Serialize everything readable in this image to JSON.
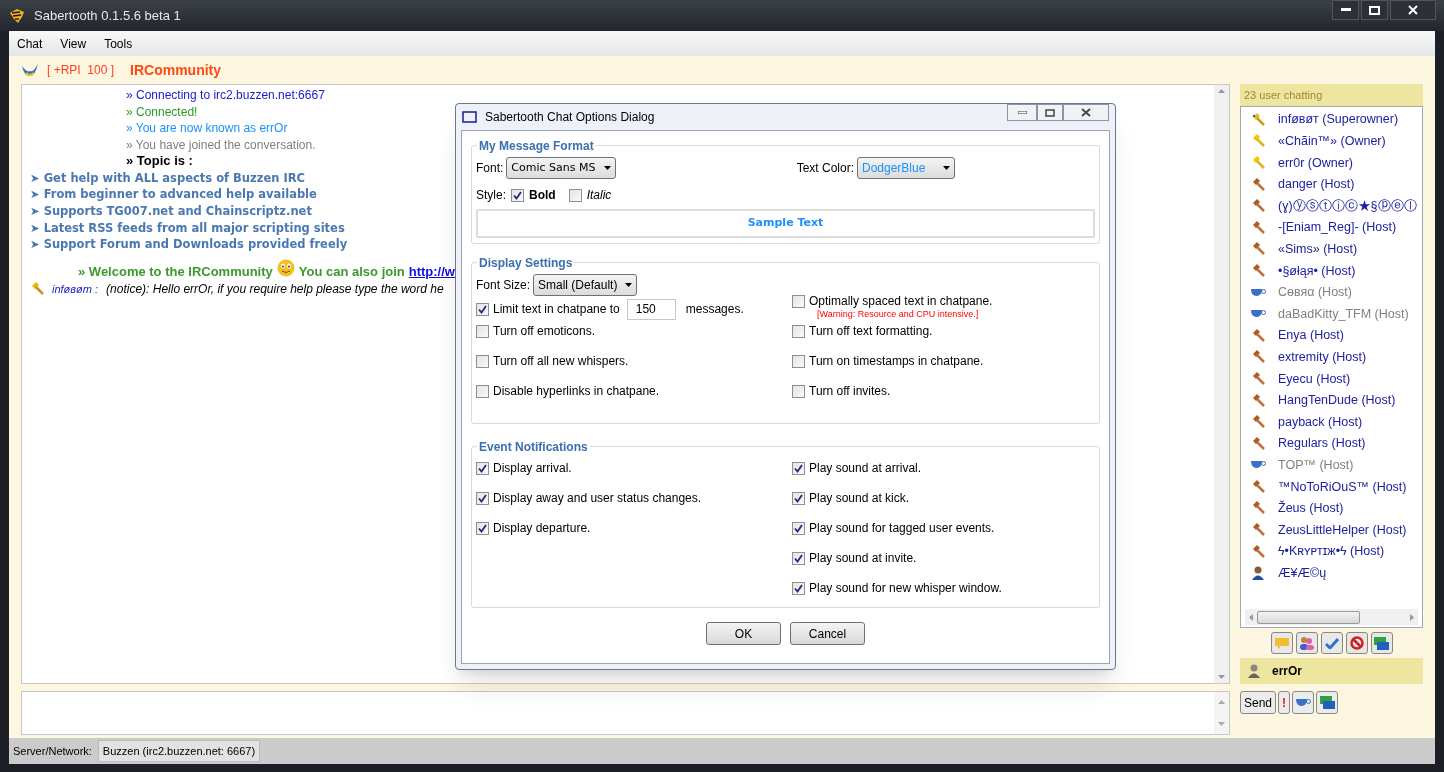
{
  "window": {
    "title": "Sabertooth 0.1.5.6 beta 1"
  },
  "menu": [
    "Chat",
    "View",
    "Tools"
  ],
  "header": {
    "rpi": "[ +RPI  100 ]",
    "room": "IRCommunity"
  },
  "chat": {
    "lines": [
      {
        "kind": "status",
        "color": "#1a1ad0",
        "text": "» Connecting to irc2.buzzen.net:6667"
      },
      {
        "kind": "status",
        "color": "#2a9a2a",
        "text": "» Connected!"
      },
      {
        "kind": "status",
        "color": "#1e90ff",
        "text": "» You are now known as errOr"
      },
      {
        "kind": "status",
        "color": "#808080",
        "text": "» You have joined the conversation."
      },
      {
        "kind": "topic_head",
        "color": "#000000",
        "text": "» Topic is :"
      },
      {
        "kind": "topic",
        "color": "#4a78b0",
        "text": "➤ Get help with ALL aspects of Buzzen IRC"
      },
      {
        "kind": "topic",
        "color": "#4a78b0",
        "text": "➤ From beginner to advanced help available"
      },
      {
        "kind": "topic",
        "color": "#4a78b0",
        "text": "➤ Supports TG007.net and Chainscriptz.net"
      },
      {
        "kind": "topic",
        "color": "#4a78b0",
        "text": "➤ Latest RSS feeds from all major scripting sites"
      },
      {
        "kind": "topic",
        "color": "#4a78b0",
        "text": "➤ Support Forum and Downloads provided freely"
      },
      {
        "kind": "welcome",
        "color": "#3a9a2a",
        "text": "» Welcome to the IRCommunity",
        "text2": "You can also join",
        "link": "http://w"
      },
      {
        "kind": "notice",
        "color": "#2020c0",
        "nick": "inføвøт :",
        "text": "(notice): Hello errOr, if you require help please type the word he"
      }
    ]
  },
  "user_panel": {
    "count": "23 user chatting",
    "users": [
      {
        "kind": "superowner",
        "name": "inføвøт (Superowner)"
      },
      {
        "kind": "owner",
        "name": "«Chãin™» (Owner)"
      },
      {
        "kind": "owner",
        "name": "err0r (Owner)"
      },
      {
        "kind": "host",
        "name": "danger (Host)"
      },
      {
        "kind": "host",
        "name": "(ɣ)ⓨⓢⓣⓘⓒ★§ⓟⓔⓛ"
      },
      {
        "kind": "host",
        "name": "-[Eniam_Reg]- (Host)"
      },
      {
        "kind": "host",
        "name": "«Sims» (Host)"
      },
      {
        "kind": "host",
        "name": "•§øłąя• (Host)"
      },
      {
        "kind": "away",
        "name": "Сөвяα (Host)"
      },
      {
        "kind": "away",
        "name": "daBadKitty_TFM (Host)"
      },
      {
        "kind": "host",
        "name": "Enya (Host)"
      },
      {
        "kind": "host",
        "name": "extremity (Host)"
      },
      {
        "kind": "host",
        "name": "Eyecu (Host)"
      },
      {
        "kind": "host",
        "name": "HangTenDude (Host)"
      },
      {
        "kind": "host",
        "name": "payback (Host)"
      },
      {
        "kind": "host",
        "name": "Regulars (Host)"
      },
      {
        "kind": "away",
        "name": "TOP™ (Host)"
      },
      {
        "kind": "host",
        "name": "™NoToRiOuS™ (Host)"
      },
      {
        "kind": "host",
        "name": "Žeus (Host)"
      },
      {
        "kind": "host",
        "name": "ZeusLittleHelper (Host)"
      },
      {
        "kind": "host",
        "name": "ϟ•Kʀʏᴘᴛɪж•ϟ (Host)"
      },
      {
        "kind": "user",
        "name": "Æ¥Æ©ų"
      }
    ],
    "current_user": "errOr"
  },
  "input": {
    "send": "Send",
    "alert": "!"
  },
  "status_bar": {
    "label": "Server/Network:",
    "value": "Buzzen (irc2.buzzen.net: 6667)"
  },
  "dialog": {
    "title": "Sabertooth Chat Options Dialog",
    "message_format": {
      "title": "My Message Format",
      "font_label": "Font:",
      "font": "Comic Sans MS",
      "color_label": "Text Color:",
      "color_value": "DodgerBlue",
      "style_label": "Style:",
      "bold": {
        "label": "Bold",
        "checked": true
      },
      "italic": {
        "label": "Italic",
        "checked": false
      },
      "sample": "Sample Text"
    },
    "display": {
      "title": "Display Settings",
      "font_size_label": "Font Size:",
      "font_size": "Small (Default)",
      "left": [
        {
          "kind": "limit",
          "label": "Limit text in chatpane to",
          "value": "150",
          "suffix": "messages.",
          "checked": true
        },
        {
          "kind": "plain",
          "label": "Turn off emoticons.",
          "checked": false
        },
        {
          "kind": "plain",
          "label": "Turn off all new whispers.",
          "checked": false
        },
        {
          "kind": "plain",
          "label": "Disable hyperlinks in chatpane.",
          "checked": false
        }
      ],
      "right": [
        {
          "kind": "warning",
          "label": "Optimally spaced text in chatpane.",
          "warning": "[Warning: Resource and CPU intensive.]",
          "checked": false
        },
        {
          "kind": "plain",
          "label": "Turn off text formatting.",
          "checked": false
        },
        {
          "kind": "plain",
          "label": "Turn on timestamps in chatpane.",
          "checked": false
        },
        {
          "kind": "plain",
          "label": "Turn off invites.",
          "checked": false
        }
      ]
    },
    "events": {
      "title": "Event Notifications",
      "left": [
        {
          "label": "Display arrival.",
          "checked": true
        },
        {
          "label": "Display away and user status changes.",
          "checked": true
        },
        {
          "label": "Display departure.",
          "checked": true
        }
      ],
      "right": [
        {
          "label": "Play sound at arrival.",
          "checked": true
        },
        {
          "label": "Play sound at kick.",
          "checked": true
        },
        {
          "label": "Play sound for tagged user events.",
          "checked": true
        },
        {
          "label": "Play sound at invite.",
          "checked": true
        },
        {
          "label": "Play sound for new whisper window.",
          "checked": true
        }
      ]
    },
    "buttons": [
      "OK",
      "Cancel"
    ]
  }
}
